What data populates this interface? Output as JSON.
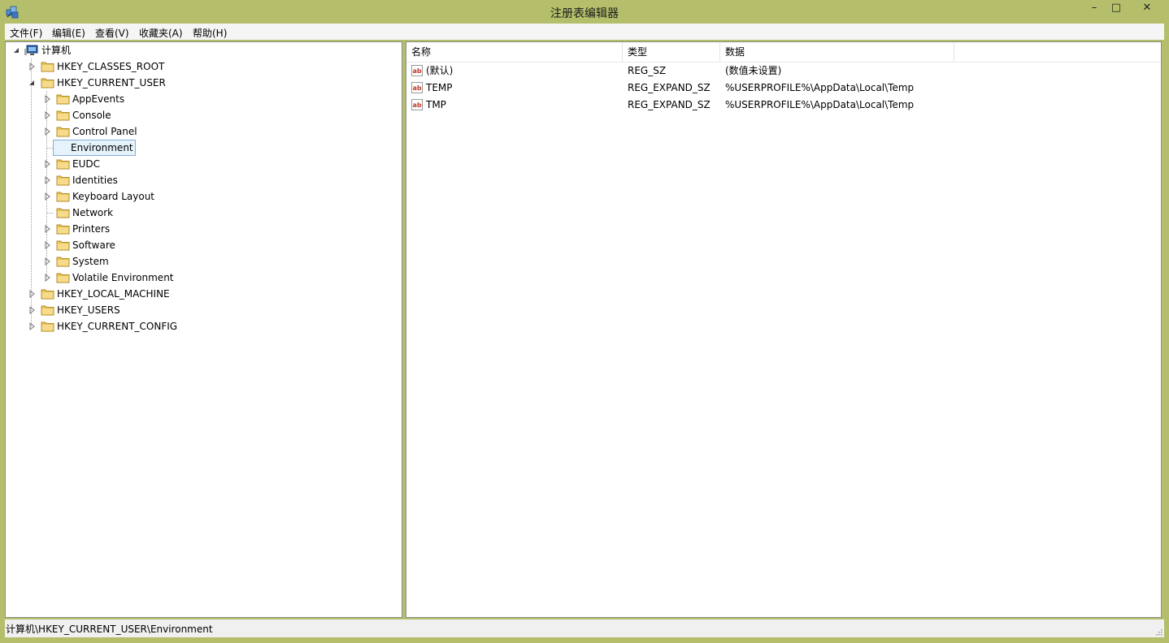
{
  "window": {
    "title": "注册表编辑器",
    "minimize": "–",
    "maximize": "□",
    "close": "✕"
  },
  "menu": [
    "文件(F)",
    "编辑(E)",
    "查看(V)",
    "收藏夹(A)",
    "帮助(H)"
  ],
  "tree": {
    "root": "计算机",
    "hives": [
      "HKEY_CLASSES_ROOT",
      "HKEY_CURRENT_USER",
      "HKEY_LOCAL_MACHINE",
      "HKEY_USERS",
      "HKEY_CURRENT_CONFIG"
    ],
    "current_user_keys": [
      "AppEvents",
      "Console",
      "Control Panel",
      "Environment",
      "EUDC",
      "Identities",
      "Keyboard Layout",
      "Network",
      "Printers",
      "Software",
      "System",
      "Volatile Environment"
    ],
    "selected": "Environment"
  },
  "list": {
    "columns": [
      "名称",
      "类型",
      "数据"
    ],
    "rows": [
      {
        "name": "(默认)",
        "type": "REG_SZ",
        "data": "(数值未设置)"
      },
      {
        "name": "TEMP",
        "type": "REG_EXPAND_SZ",
        "data": "%USERPROFILE%\\AppData\\Local\\Temp"
      },
      {
        "name": "TMP",
        "type": "REG_EXPAND_SZ",
        "data": "%USERPROFILE%\\AppData\\Local\\Temp"
      }
    ]
  },
  "status": "计算机\\HKEY_CURRENT_USER\\Environment",
  "colors": {
    "frame": "#b5bf6b",
    "selection_bg": "#e5f3fb",
    "selection_border": "#84acdd"
  }
}
